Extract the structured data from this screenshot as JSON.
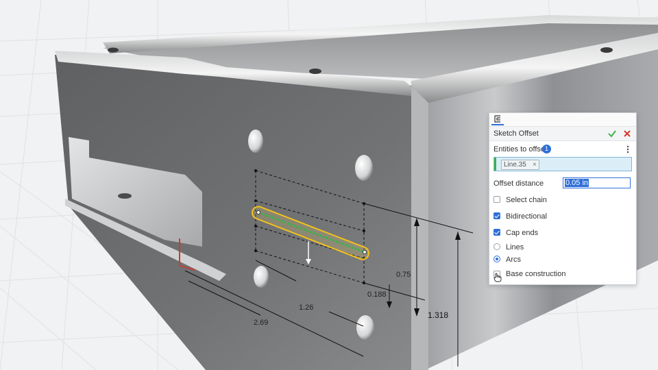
{
  "panel": {
    "title": "Sketch Offset",
    "entities_label": "Entities to offset",
    "entities_count": "1",
    "selected_entity": "Line.35",
    "offset_distance_label": "Offset distance",
    "offset_distance_value": "0.05 in",
    "options": {
      "select_chain": {
        "label": "Select chain",
        "checked": false
      },
      "bidirectional": {
        "label": "Bidirectional",
        "checked": true
      },
      "cap_ends": {
        "label": "Cap ends",
        "checked": true
      },
      "lines": {
        "label": "Lines",
        "selected": false
      },
      "arcs": {
        "label": "Arcs",
        "selected": true
      },
      "base_construction": {
        "label": "Base construction",
        "checked": false
      }
    }
  },
  "dimensions": {
    "d1": "0.75",
    "d2": "0.188",
    "d3": "1.318",
    "d4": "1.26",
    "d5": "2.69"
  },
  "colors": {
    "accent": "#2e6fd8",
    "ok": "#3bb34a",
    "cancel": "#d9342b",
    "highlight": "#f2c21b",
    "metal": "#6b6c6e"
  },
  "icons": {
    "panel_tab": "sketch-offset-icon",
    "ok": "checkmark-icon",
    "cancel": "close-icon",
    "more": "more-options-icon",
    "remove": "remove-chip-icon"
  }
}
